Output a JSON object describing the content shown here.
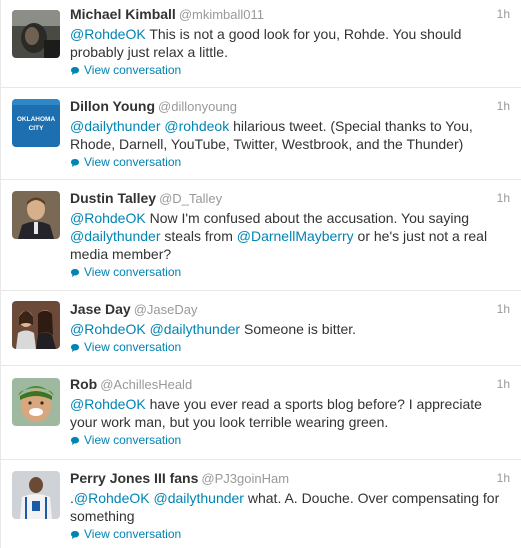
{
  "tweets": [
    {
      "name": "Michael Kimball",
      "handle": "@mkimball011",
      "time": "1h",
      "segments": [
        {
          "t": "@RohdeOK",
          "m": true
        },
        {
          "t": " This is not a good look for you, Rohde. You should probably just relax a little."
        }
      ],
      "conversation": "View conversation"
    },
    {
      "name": "Dillon Young",
      "handle": "@dillonyoung",
      "time": "1h",
      "avatar_text": [
        "OKLAHOMA",
        "CITY"
      ],
      "segments": [
        {
          "t": "@dailythunder",
          "m": true
        },
        {
          "t": " "
        },
        {
          "t": "@rohdeok",
          "m": true
        },
        {
          "t": " hilarious tweet. (Special thanks to You, Rhode, Darnell, YouTube, Twitter, Westbrook, and the Thunder)"
        }
      ],
      "conversation": "View conversation"
    },
    {
      "name": "Dustin Talley",
      "handle": "@D_Talley",
      "time": "1h",
      "segments": [
        {
          "t": "@RohdeOK",
          "m": true
        },
        {
          "t": " Now I'm confused about the accusation. You saying "
        },
        {
          "t": "@dailythunder",
          "m": true
        },
        {
          "t": " steals from "
        },
        {
          "t": "@DarnellMayberry",
          "m": true
        },
        {
          "t": " or he's just not a real media member?"
        }
      ],
      "conversation": "View conversation"
    },
    {
      "name": "Jase Day",
      "handle": "@JaseDay",
      "time": "1h",
      "segments": [
        {
          "t": "@RohdeOK",
          "m": true
        },
        {
          "t": " "
        },
        {
          "t": "@dailythunder",
          "m": true
        },
        {
          "t": " Someone is bitter."
        }
      ],
      "conversation": "View conversation"
    },
    {
      "name": "Rob",
      "handle": "@AchillesHeald",
      "time": "1h",
      "segments": [
        {
          "t": "@RohdeOK",
          "m": true
        },
        {
          "t": " have you ever read a sports blog before? I appreciate your work man, but you look terrible wearing green."
        }
      ],
      "conversation": "View conversation"
    },
    {
      "name": "Perry Jones III fans",
      "handle": "@PJ3goinHam",
      "time": "1h",
      "segments": [
        {
          "t": "."
        },
        {
          "t": "@RohdeOK",
          "m": true
        },
        {
          "t": " "
        },
        {
          "t": "@dailythunder",
          "m": true
        },
        {
          "t": " what. A. Douche. Over compensating for something"
        }
      ],
      "conversation": "View conversation"
    }
  ],
  "colors": {
    "link": "#0084b4",
    "text": "#333333",
    "muted": "#999999",
    "border": "#e8e8e8"
  },
  "icons": {
    "conversation": "speech-bubble-icon"
  }
}
